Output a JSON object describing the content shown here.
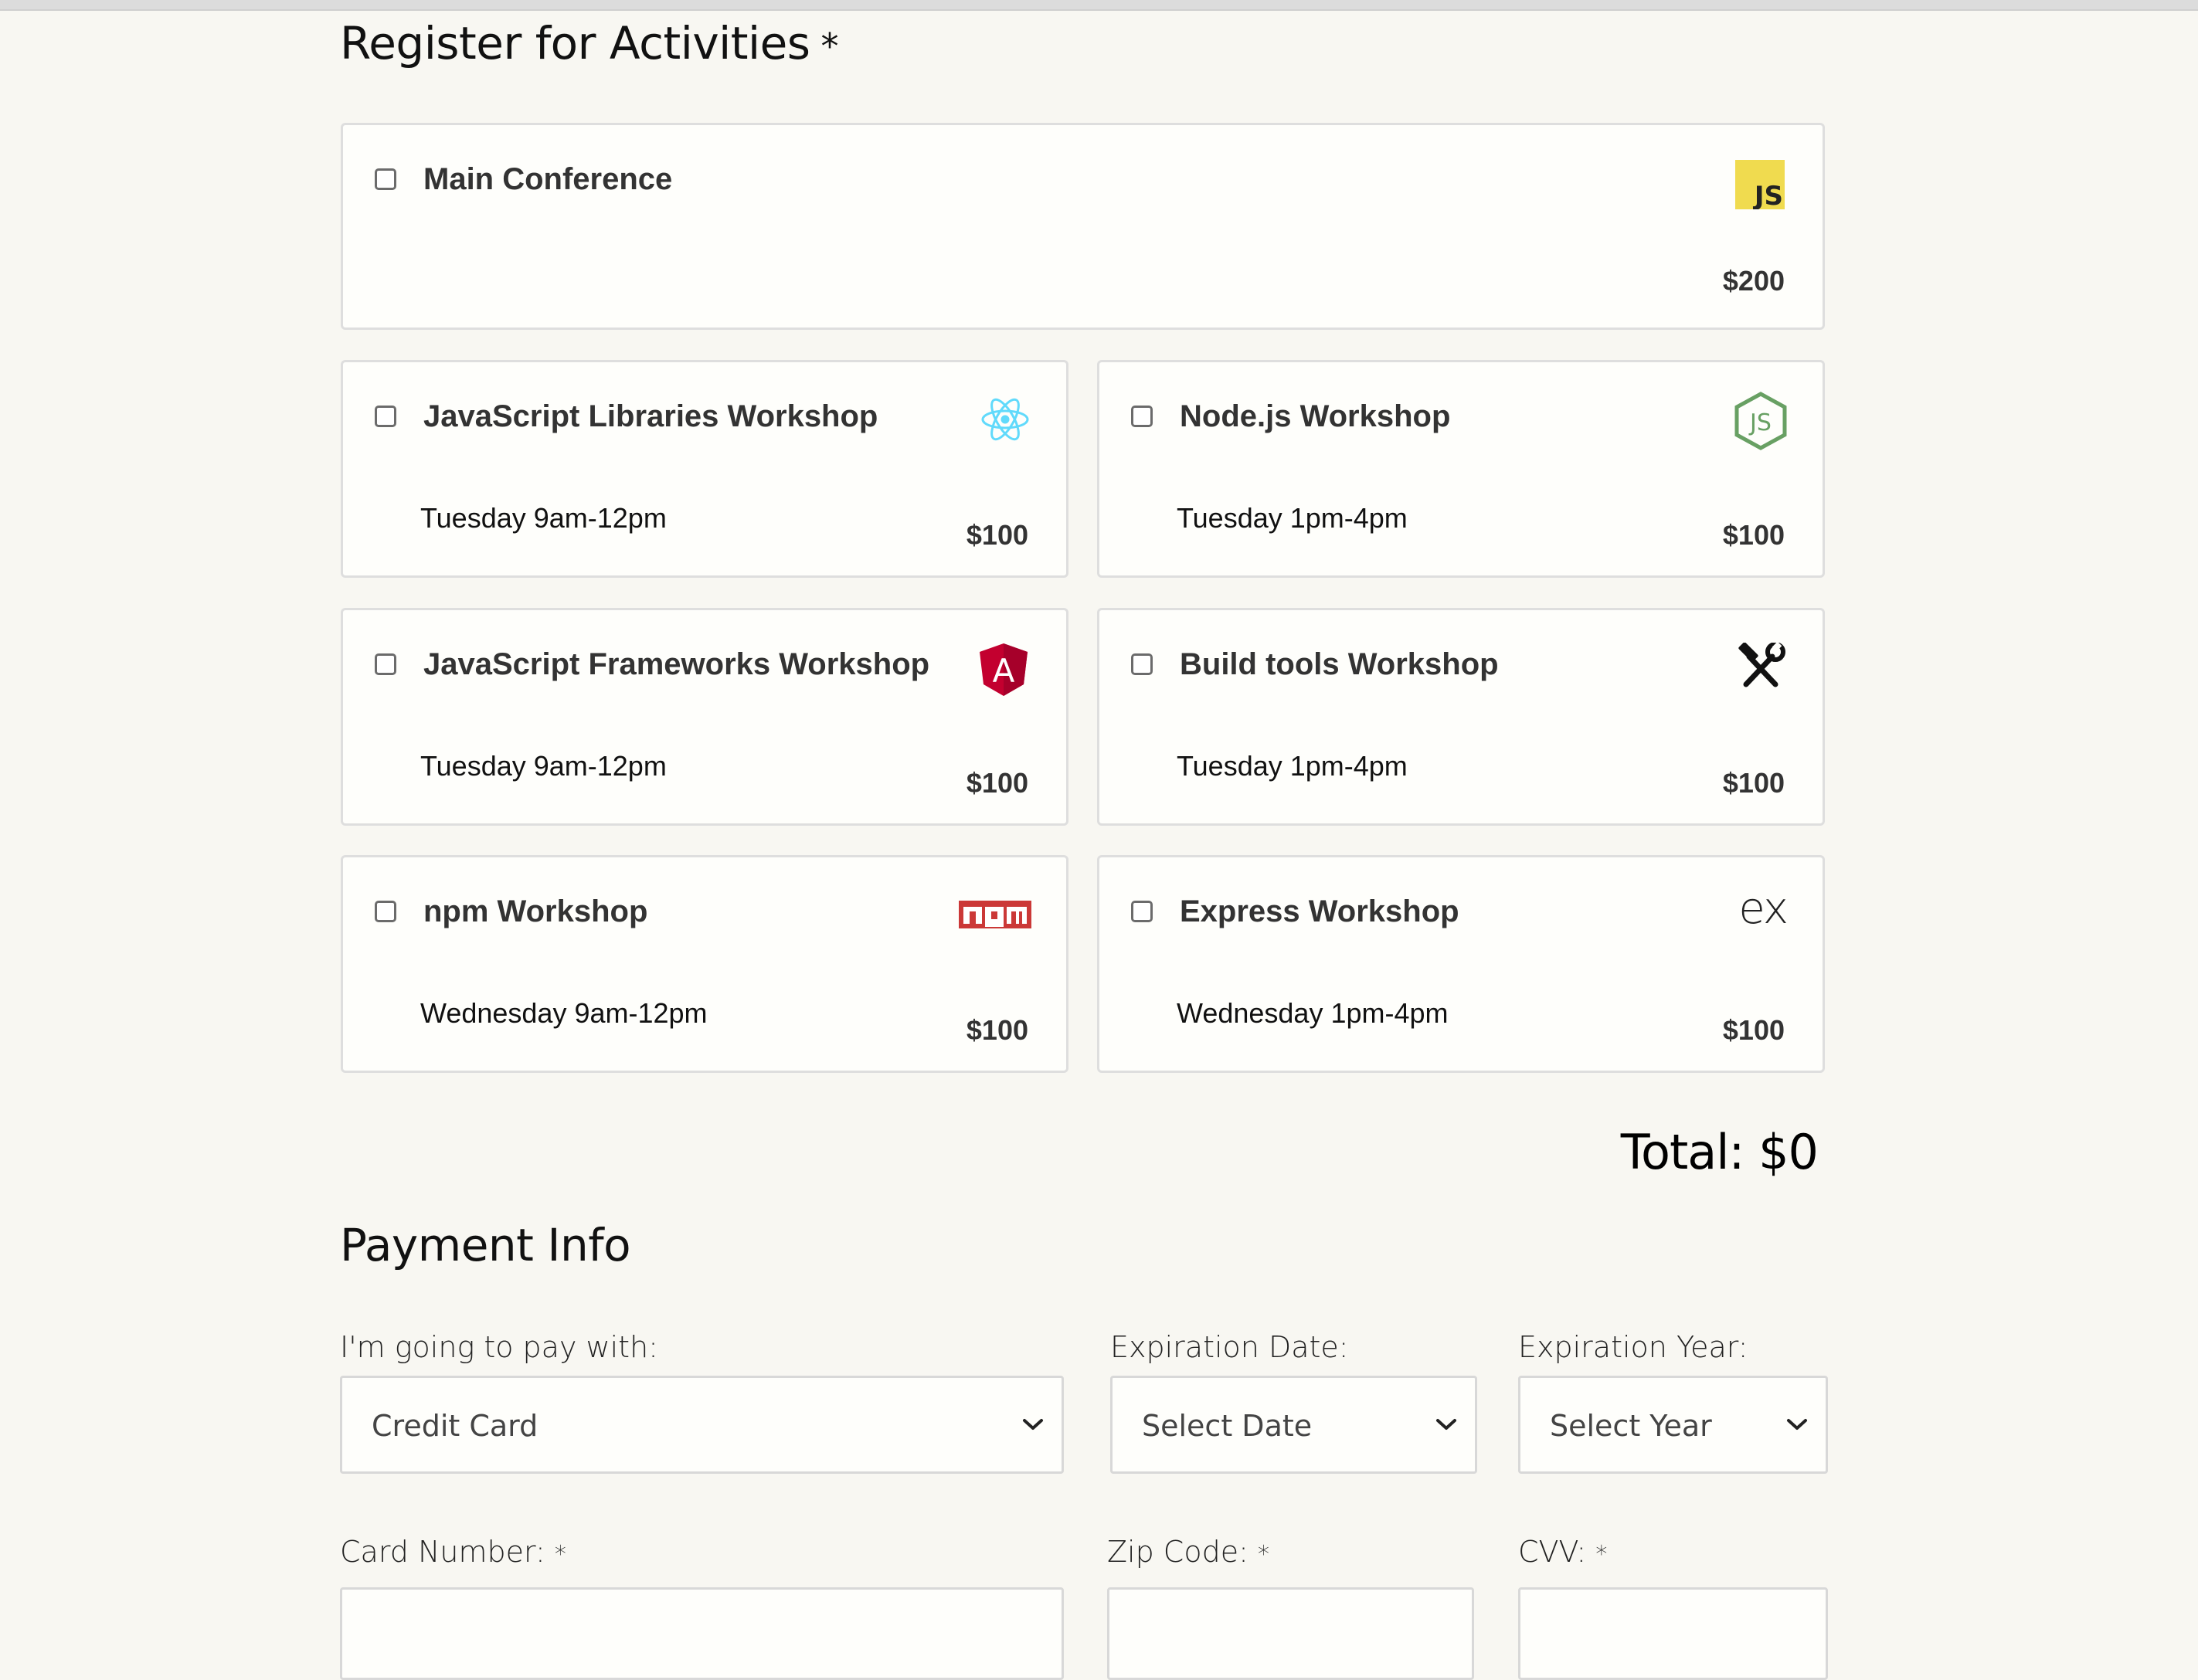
{
  "activities": {
    "title": "Register for Activities",
    "required_mark": "*",
    "main": {
      "name": "Main Conference",
      "price": "$200",
      "icon": "javascript-logo-icon",
      "icon_text": "JS"
    },
    "workshops": [
      {
        "name": "JavaScript Libraries Workshop",
        "when": "Tuesday 9am-12pm",
        "price": "$100",
        "icon": "react-logo-icon"
      },
      {
        "name": "Node.js Workshop",
        "when": "Tuesday 1pm-4pm",
        "price": "$100",
        "icon": "nodejs-logo-icon"
      },
      {
        "name": "JavaScript Frameworks Workshop",
        "when": "Tuesday 9am-12pm",
        "price": "$100",
        "icon": "angular-logo-icon"
      },
      {
        "name": "Build tools Workshop",
        "when": "Tuesday 1pm-4pm",
        "price": "$100",
        "icon": "hammer-wrench-icon"
      },
      {
        "name": "npm Workshop",
        "when": "Wednesday 9am-12pm",
        "price": "$100",
        "icon": "npm-logo-icon"
      },
      {
        "name": "Express Workshop",
        "when": "Wednesday 1pm-4pm",
        "price": "$100",
        "icon": "express-logo-icon",
        "icon_text": "ex"
      }
    ],
    "total": "Total: $0"
  },
  "payment": {
    "title": "Payment Info",
    "pay_with_label": "I'm going to pay with:",
    "pay_with_value": "Credit Card",
    "exp_date_label": "Expiration Date:",
    "exp_date_value": "Select Date",
    "exp_year_label": "Expiration Year:",
    "exp_year_value": "Select Year",
    "card_number_label": "Card Number:",
    "zip_label": "Zip Code:",
    "cvv_label": "CVV:",
    "required_mark": "*"
  },
  "colors": {
    "page_bg": "#f8f7f2",
    "card_bg": "#fefefb",
    "card_border": "#dedede",
    "js_yellow": "#f0db4f",
    "react_blue": "#61dafb",
    "node_green": "#68a063",
    "angular_red": "#c3002f",
    "npm_red": "#cb3837"
  }
}
